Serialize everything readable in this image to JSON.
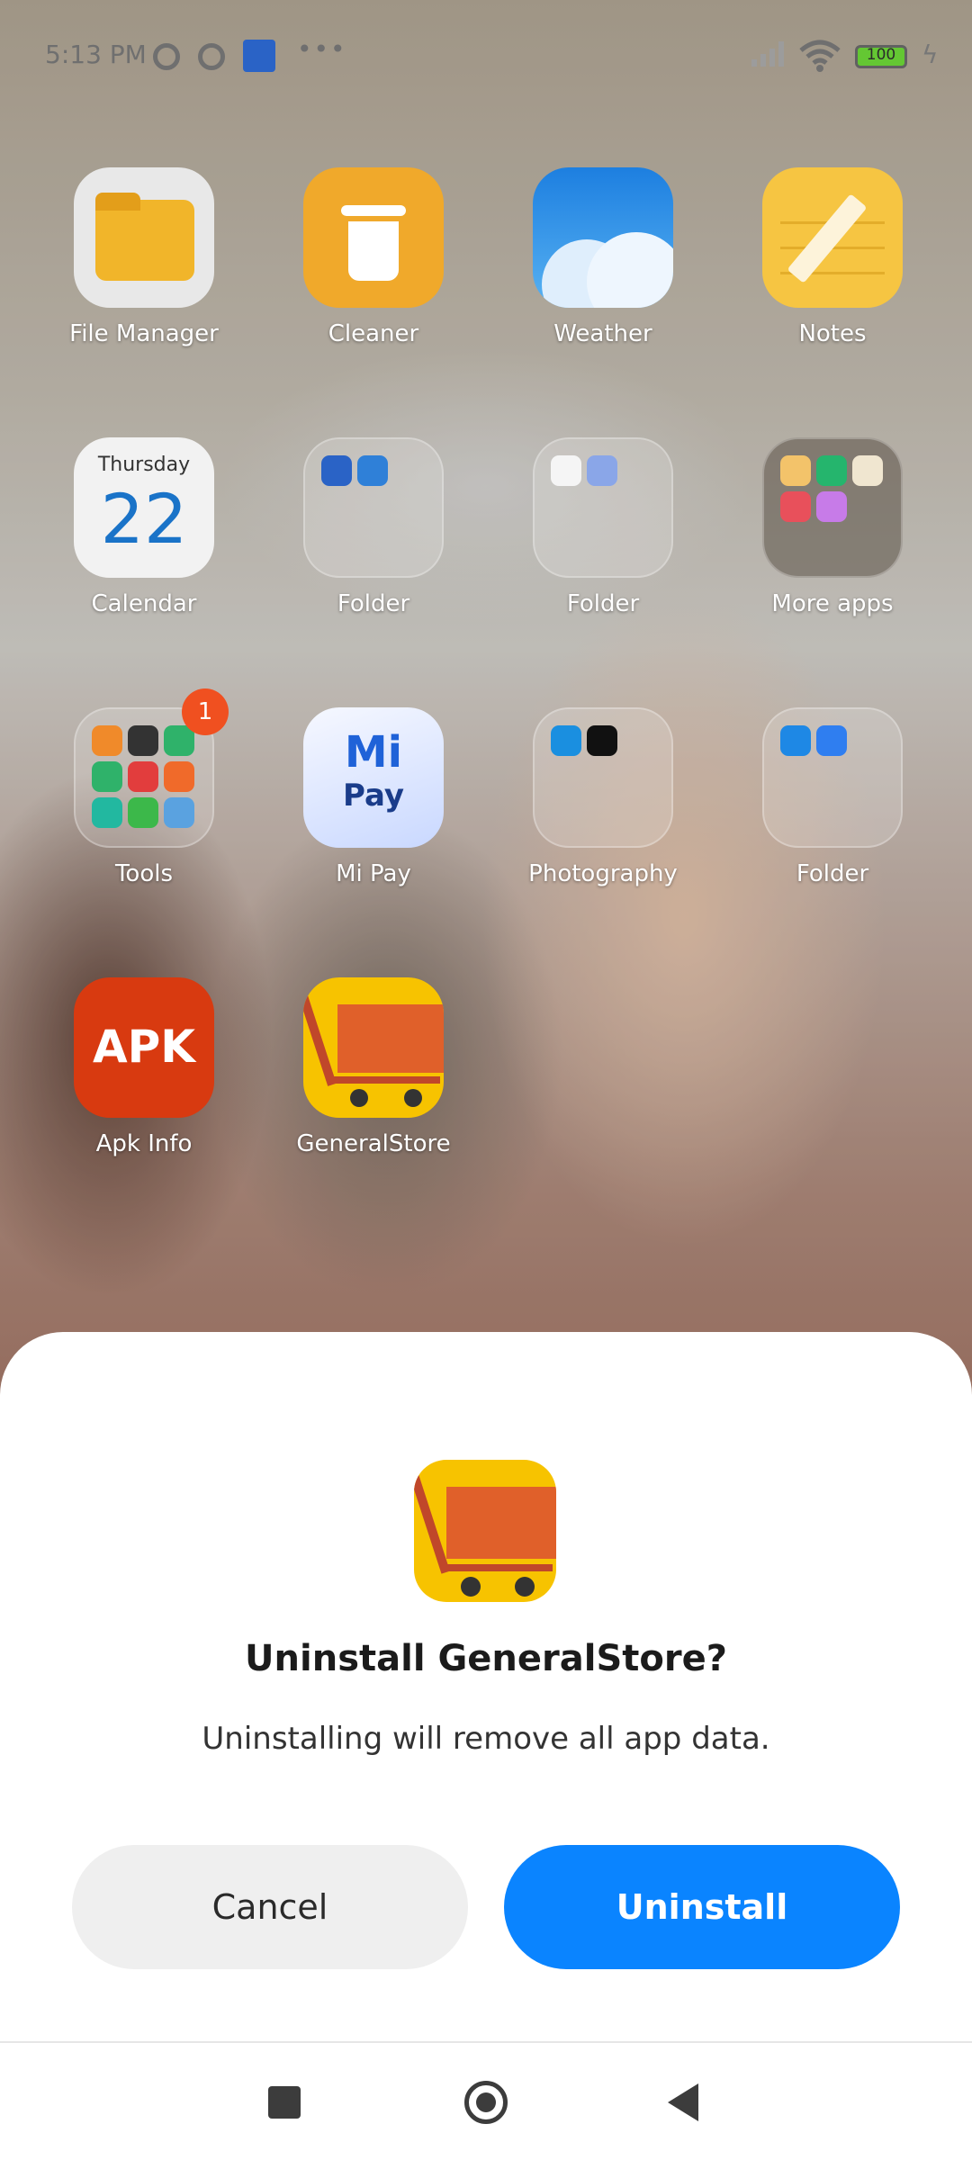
{
  "status_bar": {
    "time": "5:13 PM",
    "battery": "100"
  },
  "home": {
    "apps": [
      {
        "label": "File Manager"
      },
      {
        "label": "Cleaner"
      },
      {
        "label": "Weather"
      },
      {
        "label": "Notes"
      },
      {
        "label": "Calendar",
        "day": "Thursday",
        "date": "22"
      },
      {
        "label": "Folder"
      },
      {
        "label": "Folder"
      },
      {
        "label": "More apps"
      },
      {
        "label": "Tools",
        "badge": "1"
      },
      {
        "label": "Mi Pay",
        "icon_text_top": "Mi",
        "icon_text_bottom": "Pay"
      },
      {
        "label": "Photography"
      },
      {
        "label": "Folder"
      },
      {
        "label": "Apk Info",
        "icon_text": "APK"
      },
      {
        "label": "GeneralStore"
      }
    ]
  },
  "dialog": {
    "title": "Uninstall GeneralStore?",
    "message": "Uninstalling will remove all app data.",
    "cancel_label": "Cancel",
    "confirm_label": "Uninstall"
  },
  "colors": {
    "accent": "#0a84ff",
    "store_yellow": "#f7c300",
    "store_orange": "#e0602a"
  }
}
